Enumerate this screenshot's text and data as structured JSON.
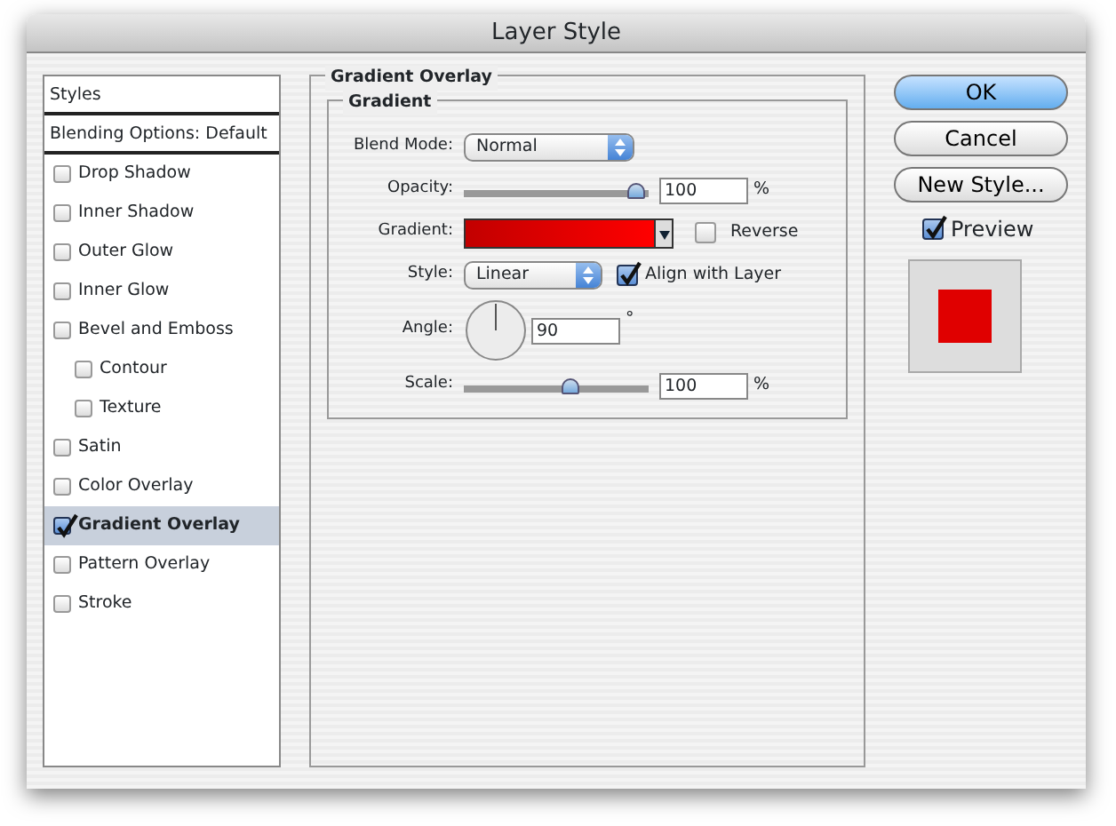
{
  "window": {
    "title": "Layer Style"
  },
  "sidebar": {
    "header": "Styles",
    "blending": "Blending Options: Default",
    "items": [
      {
        "label": "Drop Shadow",
        "checked": false,
        "selected": false
      },
      {
        "label": "Inner Shadow",
        "checked": false,
        "selected": false
      },
      {
        "label": "Outer Glow",
        "checked": false,
        "selected": false
      },
      {
        "label": "Inner Glow",
        "checked": false,
        "selected": false
      },
      {
        "label": "Bevel and Emboss",
        "checked": false,
        "selected": false,
        "children": [
          {
            "label": "Contour",
            "checked": false,
            "selected": false
          },
          {
            "label": "Texture",
            "checked": false,
            "selected": false
          }
        ]
      },
      {
        "label": "Satin",
        "checked": false,
        "selected": false
      },
      {
        "label": "Color Overlay",
        "checked": false,
        "selected": false
      },
      {
        "label": "Gradient Overlay",
        "checked": true,
        "selected": true
      },
      {
        "label": "Pattern Overlay",
        "checked": false,
        "selected": false
      },
      {
        "label": "Stroke",
        "checked": false,
        "selected": false
      }
    ]
  },
  "panel": {
    "title": "Gradient Overlay",
    "group_title": "Gradient",
    "blend_mode": {
      "label": "Blend Mode:",
      "value": "Normal"
    },
    "opacity": {
      "label": "Opacity:",
      "level": 1,
      "value": "100",
      "unit": "%"
    },
    "gradient": {
      "label": "Gradient:",
      "reverse": {
        "label": "Reverse",
        "checked": false
      }
    },
    "style": {
      "label": "Style:",
      "value": "Linear",
      "align": {
        "label": "Align with Layer",
        "checked": true
      }
    },
    "angle": {
      "label": "Angle:",
      "value": "90",
      "unit": "°"
    },
    "scale": {
      "label": "Scale:",
      "level": 0.6,
      "value": "100",
      "unit": "%"
    }
  },
  "buttons": [
    {
      "label": "OK",
      "default": true
    },
    {
      "label": "Cancel",
      "default": false
    },
    {
      "label": "New Style...",
      "default": false
    }
  ],
  "preview": {
    "label": "Preview",
    "checked": true
  }
}
